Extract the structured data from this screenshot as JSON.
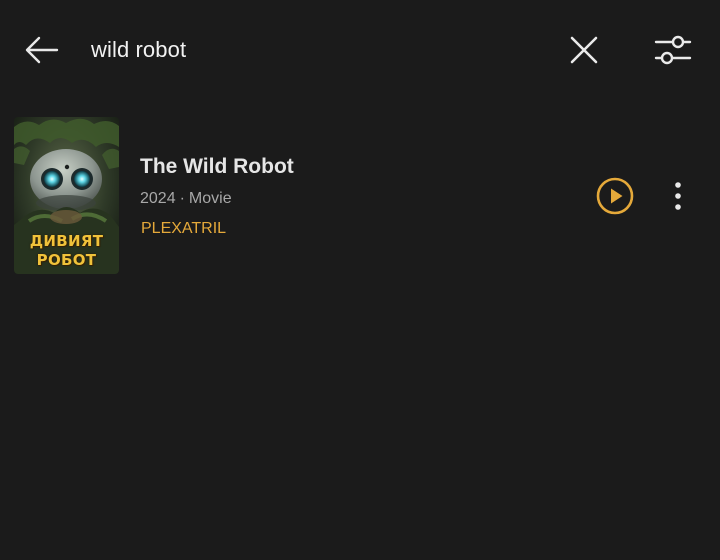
{
  "search": {
    "query": "wild robot",
    "back_icon": "arrow-left-icon",
    "clear_icon": "close-icon",
    "filter_icon": "sliders-icon"
  },
  "results": [
    {
      "title": "The Wild Robot",
      "year": "2024",
      "separator": "·",
      "type": "Movie",
      "source": "PLEXATRIL",
      "poster_text": [
        "ДИВИЯТ",
        "РОБОТ"
      ],
      "play_icon": "play-circle-icon",
      "more_icon": "more-vertical-icon"
    }
  ],
  "colors": {
    "background": "#1b1b1b",
    "accent": "#e5a93a",
    "text_primary": "#e6e6e6",
    "text_secondary": "#a8a8a8"
  }
}
